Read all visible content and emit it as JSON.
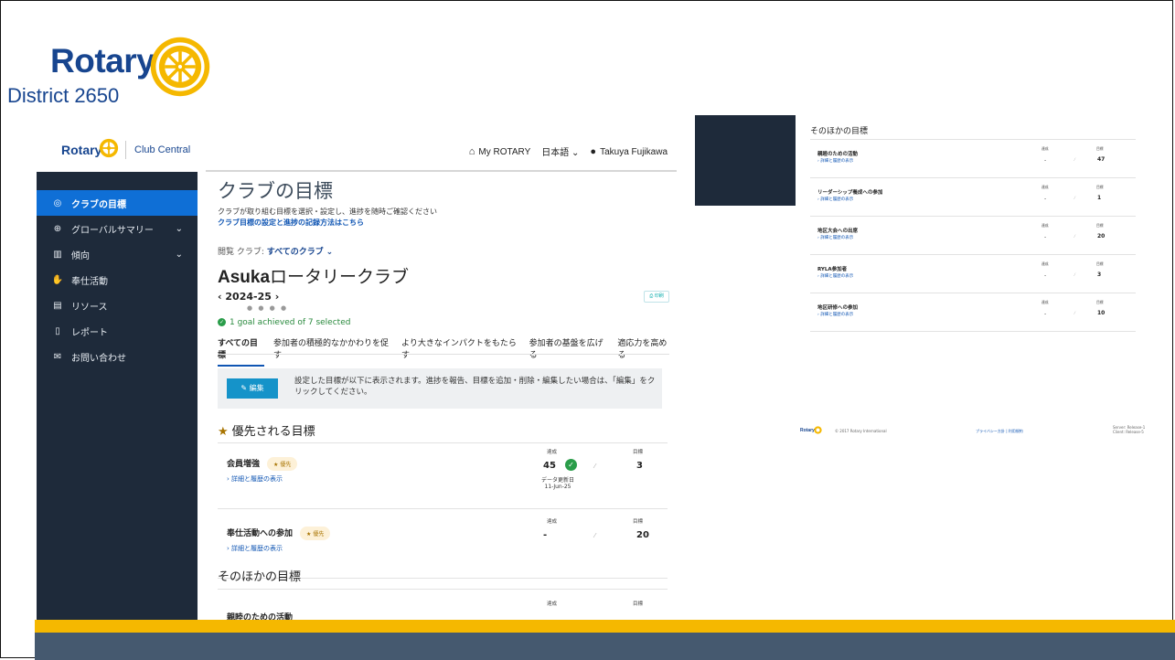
{
  "district": {
    "brand": "Rotary",
    "name": "District 2650"
  },
  "app": {
    "brand": "Rotary",
    "product": "Club Central",
    "topnav": {
      "myrotary": "My ROTARY",
      "language": "日本語",
      "user": "Takuya Fujikawa"
    },
    "sidebar": [
      {
        "label": "クラブの目標",
        "icon": "target-icon",
        "glyph": "◎",
        "active": true,
        "chevron": false
      },
      {
        "label": "グローバルサマリー",
        "icon": "globe-icon",
        "glyph": "⊕",
        "active": false,
        "chevron": true
      },
      {
        "label": "傾向",
        "icon": "bar-chart-icon",
        "glyph": "▥",
        "active": false,
        "chevron": true
      },
      {
        "label": "奉仕活動",
        "icon": "service-hand-icon",
        "glyph": "✋",
        "active": false,
        "chevron": false
      },
      {
        "label": "リソース",
        "icon": "book-icon",
        "glyph": "▤",
        "active": false,
        "chevron": false
      },
      {
        "label": "レポート",
        "icon": "document-icon",
        "glyph": "▯",
        "active": false,
        "chevron": false
      },
      {
        "label": "お問い合わせ",
        "icon": "mail-icon",
        "glyph": "✉",
        "active": false,
        "chevron": false
      }
    ],
    "page": {
      "title": "クラブの目標",
      "subtitle": "クラブが取り組む目標を選択・設定し、進捗を随時ご確認ください",
      "help_link": "クラブ目標の設定と進捗の記録方法はこちら",
      "filter_label": "閲覧 クラブ:",
      "filter_value": "すべてのクラブ",
      "club_bold": "Asuka",
      "club_rest": "ロータリークラブ",
      "year": "2024-25",
      "print_label": "印刷",
      "goal_status": "1 goal achieved of 7 selected",
      "tabs": [
        "すべての目標",
        "参加者の積極的なかかわりを促す",
        "より大きなインパクトをもたらす",
        "参加者の基盤を広げる",
        "適応力を高める"
      ],
      "edit_button": "編集",
      "edit_message": "設定した目標が以下に表示されます。進捗を報告、目標を追加・削除・編集したい場合は、「編集」をクリックしてください。",
      "priority_title": "優先される目標",
      "other_title": "そのほかの目標",
      "col_achieved": "達成",
      "col_goal": "目標",
      "detail_link": "詳細と履歴の表示",
      "priority_badge": "優先",
      "updated_label": "データ更新日",
      "updated_date": "11-Jun-25",
      "priority_goals": [
        {
          "name": "会員増強",
          "achieved": "45",
          "goal": "3",
          "done": true
        },
        {
          "name": "奉仕活動への参加",
          "achieved": "-",
          "goal": "20",
          "done": false
        }
      ],
      "other_first": {
        "name": "親睦のための活動",
        "achieved": "-",
        "goal": "47"
      }
    }
  },
  "right_panel": {
    "title": "そのほかの目標",
    "col_achieved": "達成",
    "col_goal": "目標",
    "detail_link": "詳細と履歴の表示",
    "goals": [
      {
        "name": "親睦のための活動",
        "achieved": "-",
        "goal": "47"
      },
      {
        "name": "リーダーシップ養成への参加",
        "achieved": "-",
        "goal": "1"
      },
      {
        "name": "地区大会への出席",
        "achieved": "-",
        "goal": "20"
      },
      {
        "name": "RYLA参加者",
        "achieved": "-",
        "goal": "3"
      },
      {
        "name": "地区研修への参加",
        "achieved": "-",
        "goal": "10"
      }
    ],
    "footer": {
      "brand": "Rotary",
      "copyright": "© 2017 Rotary International",
      "links": "プライバシー方針 | 利用規約",
      "server": "Server: Release-1",
      "client": "Client: Release-5"
    }
  },
  "colors": {
    "rotary_blue": "#17458f",
    "rotary_gold": "#f5b800",
    "sidebar": "#1e2a3a",
    "active": "#0f6fd6",
    "edit_button": "#1593c9",
    "success": "#2a9d4a",
    "footer_bar": "#45596f"
  }
}
